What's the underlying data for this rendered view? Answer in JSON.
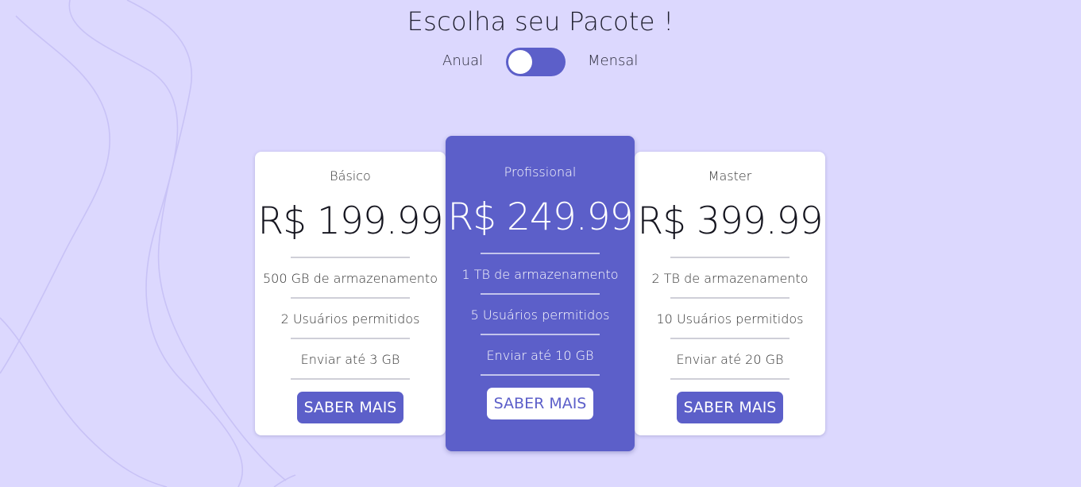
{
  "page": {
    "title": "Escolha seu Pacote !",
    "toggle": {
      "left_label": "Anual",
      "right_label": "Mensal",
      "state": "Anual"
    }
  },
  "colors": {
    "background": "#dcd8fe",
    "accent": "#5c5fc9",
    "card": "#ffffff"
  },
  "plans": [
    {
      "name": "Básico",
      "price": "R$ 199.99",
      "features": [
        "500 GB de armazenamento",
        "2 Usuários permitidos",
        "Enviar até 3 GB"
      ],
      "button": "SABER MAIS",
      "featured": false
    },
    {
      "name": "Profissional",
      "price": "R$ 249.99",
      "features": [
        "1 TB de armazenamento",
        "5 Usuários permitidos",
        "Enviar até 10 GB"
      ],
      "button": "SABER MAIS",
      "featured": true
    },
    {
      "name": "Master",
      "price": "R$ 399.99",
      "features": [
        "2 TB de armazenamento",
        "10 Usuários permitidos",
        "Enviar até 20 GB"
      ],
      "button": "SABER MAIS",
      "featured": false
    }
  ]
}
